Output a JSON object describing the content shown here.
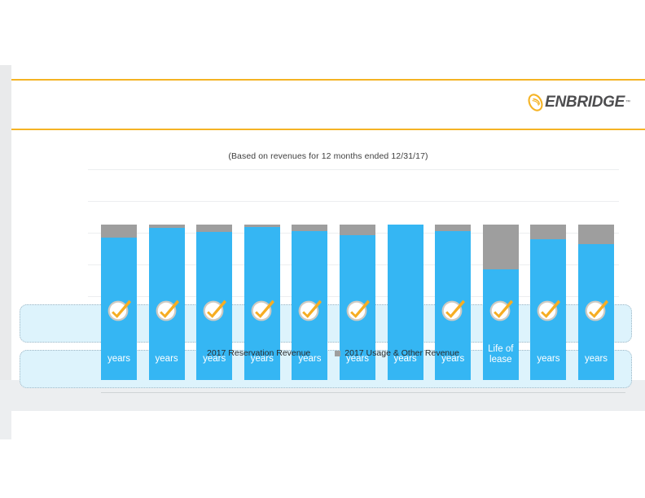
{
  "brand": {
    "logo_text": "ENBRIDGE",
    "logo_tm": "™",
    "accent_color": "#f5b324",
    "logo_text_color": "#4d4d4f"
  },
  "slide": {
    "subtitle": "(Based on revenues for 12 months ended 12/31/17)"
  },
  "legend": {
    "items": [
      {
        "label": "2017 Reservation Revenue",
        "color": "#35b6f3"
      },
      {
        "label": "2017 Usage & Other Revenue",
        "color": "#9e9e9e"
      }
    ]
  },
  "chart_data": {
    "type": "bar",
    "title": "",
    "subtitle": "(Based on revenues for 12 months ended 12/31/17)",
    "xlabel": "",
    "ylabel": "",
    "stacked": true,
    "grid": true,
    "legend_position": "bottom",
    "categories": [
      "",
      "",
      "",
      "",
      "",
      "",
      "",
      "",
      "",
      "",
      ""
    ],
    "bar_labels": [
      "years",
      "years",
      "years",
      "years",
      "years",
      "years",
      "years",
      "years",
      "Life of lease",
      "years",
      "years"
    ],
    "series": [
      {
        "name": "2017 Reservation Revenue",
        "color": "#35b6f3",
        "values": [
          91.5,
          97.9,
          95.2,
          98.4,
          95.8,
          93.1,
          100.0,
          95.8,
          71.0,
          90.5,
          87.4
        ]
      },
      {
        "name": "2017 Usage & Other Revenue",
        "color": "#9e9e9e",
        "values": [
          8.5,
          2.1,
          4.8,
          1.6,
          4.2,
          6.9,
          0.0,
          4.2,
          29.0,
          9.5,
          12.6
        ]
      }
    ],
    "ylim": [
      0,
      100
    ],
    "bar_badges": [
      true,
      true,
      true,
      true,
      true,
      true,
      false,
      true,
      true,
      true,
      true
    ],
    "badge_icon": "check-badge-icon"
  },
  "callouts": [
    {
      "text": ""
    },
    {
      "text": ""
    }
  ]
}
